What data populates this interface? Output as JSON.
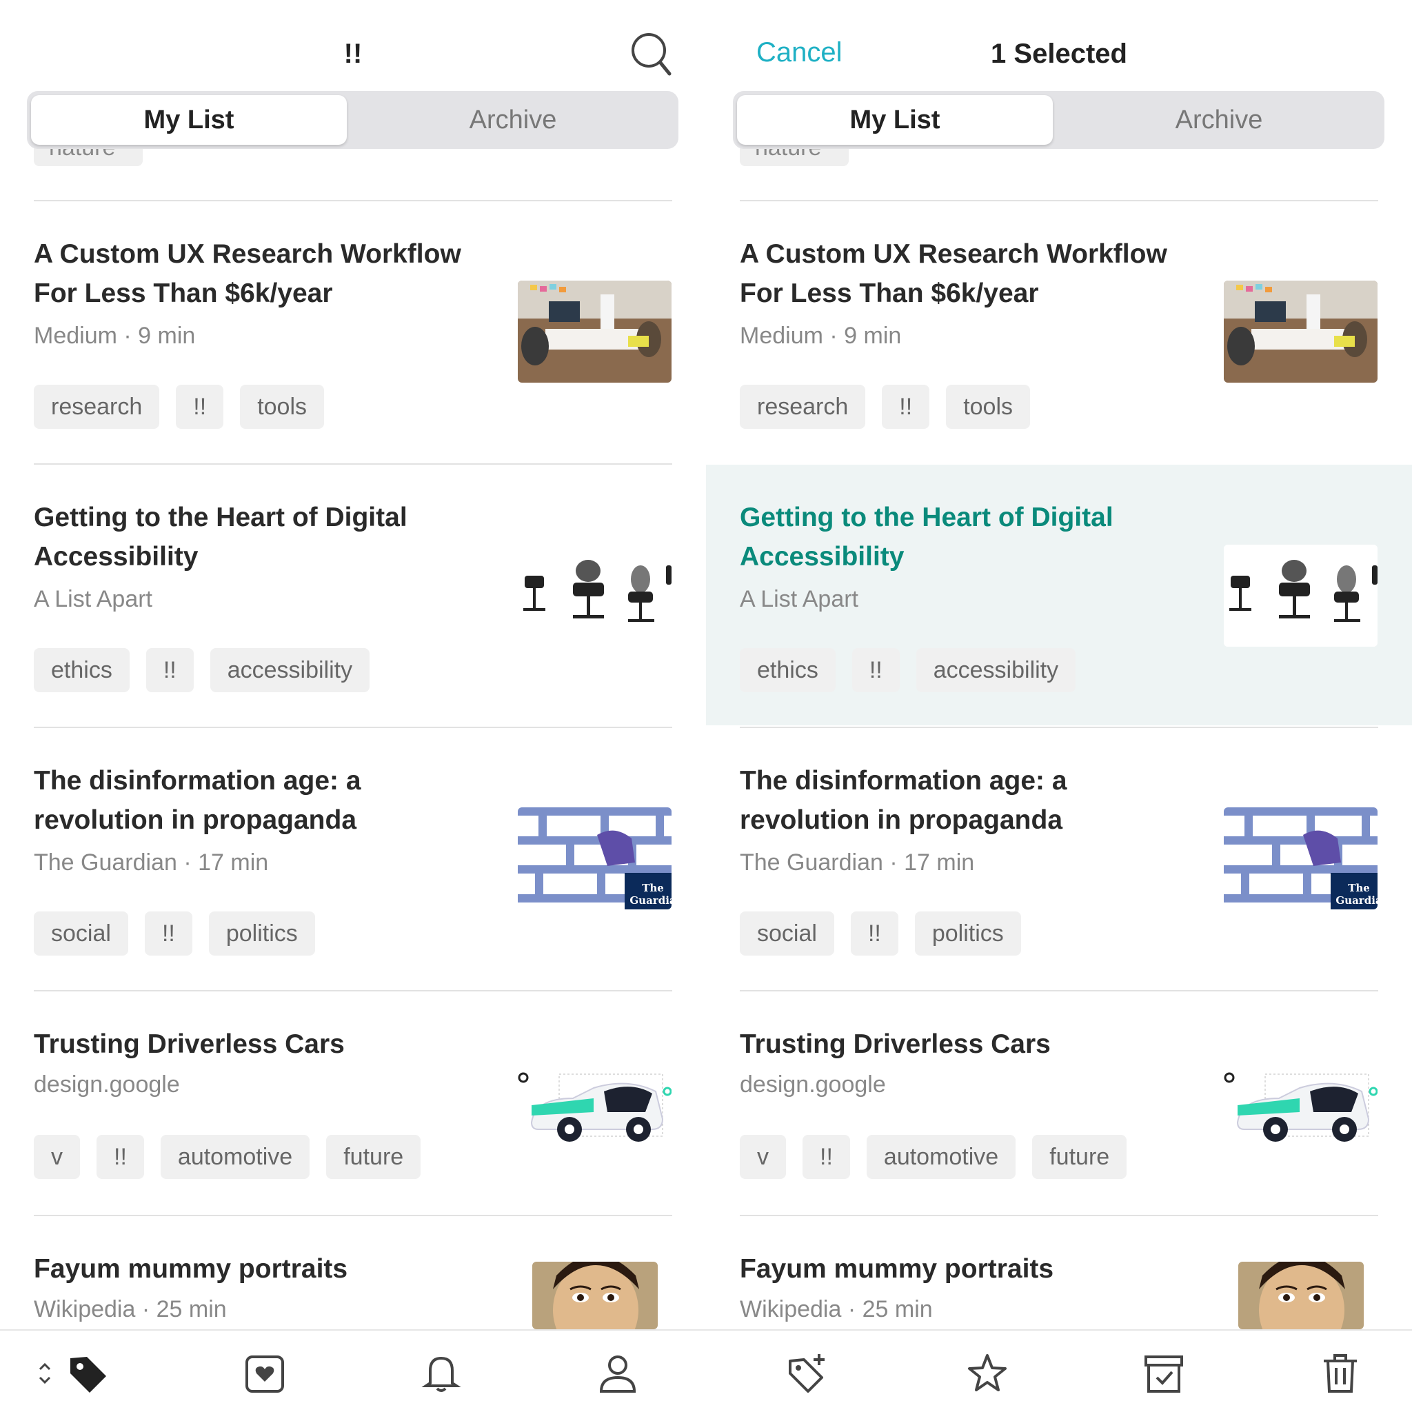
{
  "left": {
    "title": "!!",
    "tabs": {
      "my_list": "My List",
      "archive": "Archive"
    },
    "peek_tag": "nature"
  },
  "right": {
    "cancel": "Cancel",
    "title": "1 Selected",
    "tabs": {
      "my_list": "My List",
      "archive": "Archive"
    },
    "peek_tag": "nature"
  },
  "articles": [
    {
      "title_line1": "A Custom UX Research Workflow",
      "title_line2": "For Less Than $6k/year",
      "meta": "Medium · 9 min",
      "tags": [
        "research",
        "!!",
        "tools"
      ],
      "thumb": "office-photo"
    },
    {
      "title_line1": "Getting to the Heart of Digital",
      "title_line2": "Accessibility",
      "meta": "A List Apart",
      "tags": [
        "ethics",
        "!!",
        "accessibility"
      ],
      "thumb": "office-chairs"
    },
    {
      "title_line1": "The disinformation age: a",
      "title_line2": "revolution in propaganda",
      "meta": "The Guardian · 17 min",
      "tags": [
        "social",
        "!!",
        "politics"
      ],
      "thumb": "guardian-wall",
      "thumb_logo_line1": "The",
      "thumb_logo_line2": "Guardia"
    },
    {
      "title_line1": "Trusting Driverless Cars",
      "title_line2": "",
      "meta": "design.google",
      "tags": [
        "v",
        "!!",
        "automotive",
        "future"
      ],
      "thumb": "driverless-car"
    },
    {
      "title_line1": "Fayum mummy portraits",
      "title_line2": "",
      "meta": "Wikipedia · 25 min",
      "tags": [],
      "thumb": "mummy-portrait"
    }
  ],
  "bottom_left_icons": [
    "sort-icon",
    "tag-icon",
    "heart-icon",
    "bell-icon",
    "profile-icon"
  ],
  "bottom_right_icons": [
    "add-tag-icon",
    "star-icon",
    "archive-icon",
    "trash-icon"
  ],
  "colors": {
    "accent": "#1EB0C4",
    "selected_title": "#0A8A7B",
    "selected_bg": "#EEF4F4"
  }
}
